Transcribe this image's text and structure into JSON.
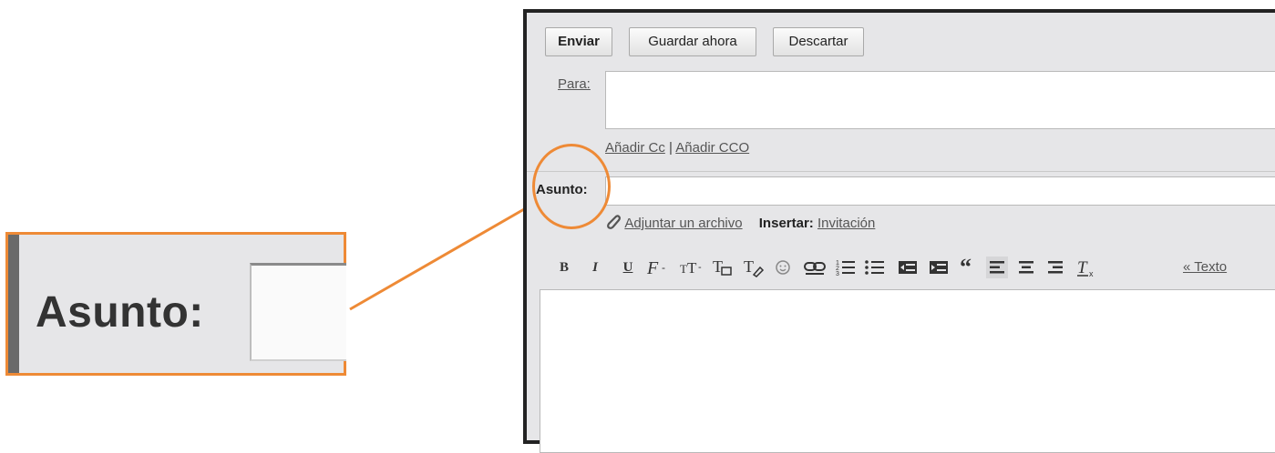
{
  "zoom": {
    "label": "Asunto:"
  },
  "toolbar": {
    "send_label": "Enviar",
    "save_label": "Guardar ahora",
    "discard_label": "Descartar"
  },
  "to": {
    "label": "Para:",
    "value": ""
  },
  "cc": {
    "add_cc": "Añadir Cc",
    "separator": "|",
    "add_bcc": "Añadir CCO"
  },
  "subject": {
    "label": "Asunto:",
    "value": ""
  },
  "attach": {
    "link": "Adjuntar un archivo",
    "insert_label": "Insertar:",
    "insert_link": "Invitación"
  },
  "format": {
    "bold": "B",
    "italic": "I",
    "underline": "U",
    "plain_text_link": "« Texto"
  },
  "colors": {
    "accent": "#ee8a36",
    "frame": "#232323",
    "panel": "#e6e6e8"
  },
  "icons": [
    "paperclip-icon",
    "font-icon",
    "font-size-icon",
    "text-color-icon",
    "highlight-icon",
    "smiley-icon",
    "link-icon",
    "numbered-list-icon",
    "bullet-list-icon",
    "indent-less-icon",
    "indent-more-icon",
    "quote-icon",
    "align-left-icon",
    "align-center-icon",
    "align-right-icon",
    "remove-formatting-icon"
  ]
}
